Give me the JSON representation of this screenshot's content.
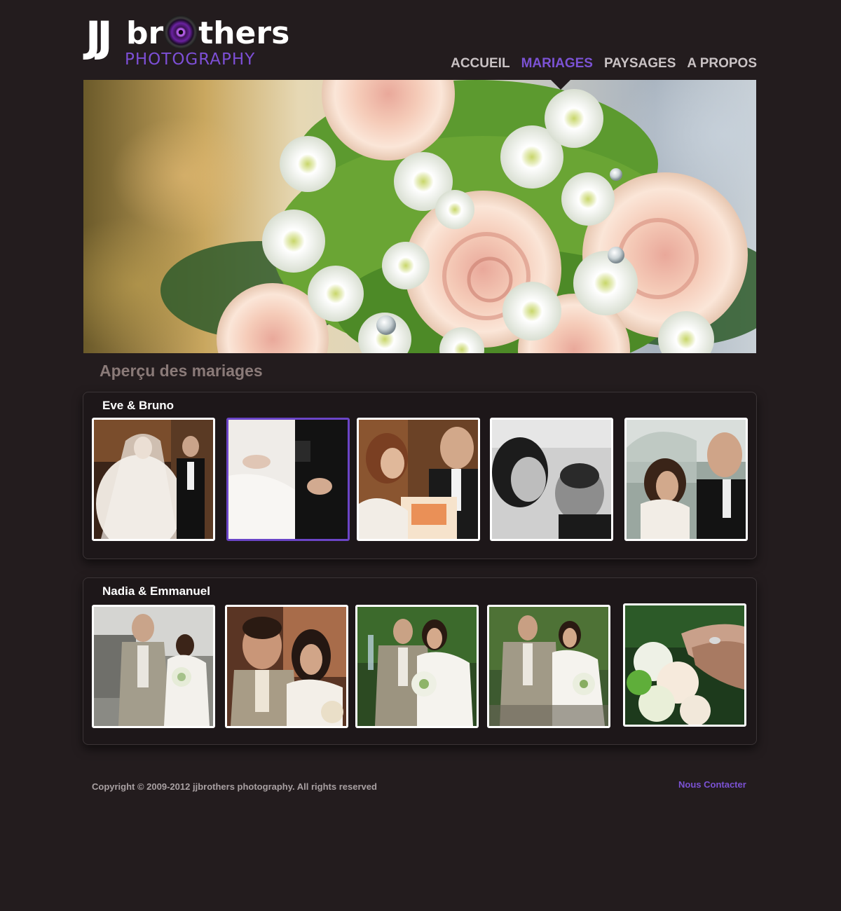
{
  "brand": {
    "logo_initials": "JJ",
    "logo_word_start": "br",
    "logo_word_end": "thers",
    "logo_subtitle": "PHOTOGRAPHY",
    "accent_color": "#7b52d4",
    "background_color": "#231c1e"
  },
  "nav": {
    "items": [
      {
        "label": "ACCUEIL",
        "active": false
      },
      {
        "label": "MARIAGES",
        "active": true
      },
      {
        "label": "PAYSAGES",
        "active": false
      },
      {
        "label": "A PROPOS",
        "active": false
      }
    ]
  },
  "hero": {
    "subject": "wedding-bouquet-photo"
  },
  "main": {
    "section_title": "Aperçu des mariages",
    "galleries": [
      {
        "title": "Eve & Bruno",
        "selected_index": 1,
        "photo_count": 5
      },
      {
        "title": "Nadia & Emmanuel",
        "selected_index": -1,
        "photo_count": 5
      }
    ]
  },
  "footer": {
    "copyright": "Copyright © 2009-2012 jjbrothers photography. All rights reserved",
    "contact_label": "Nous Contacter"
  }
}
